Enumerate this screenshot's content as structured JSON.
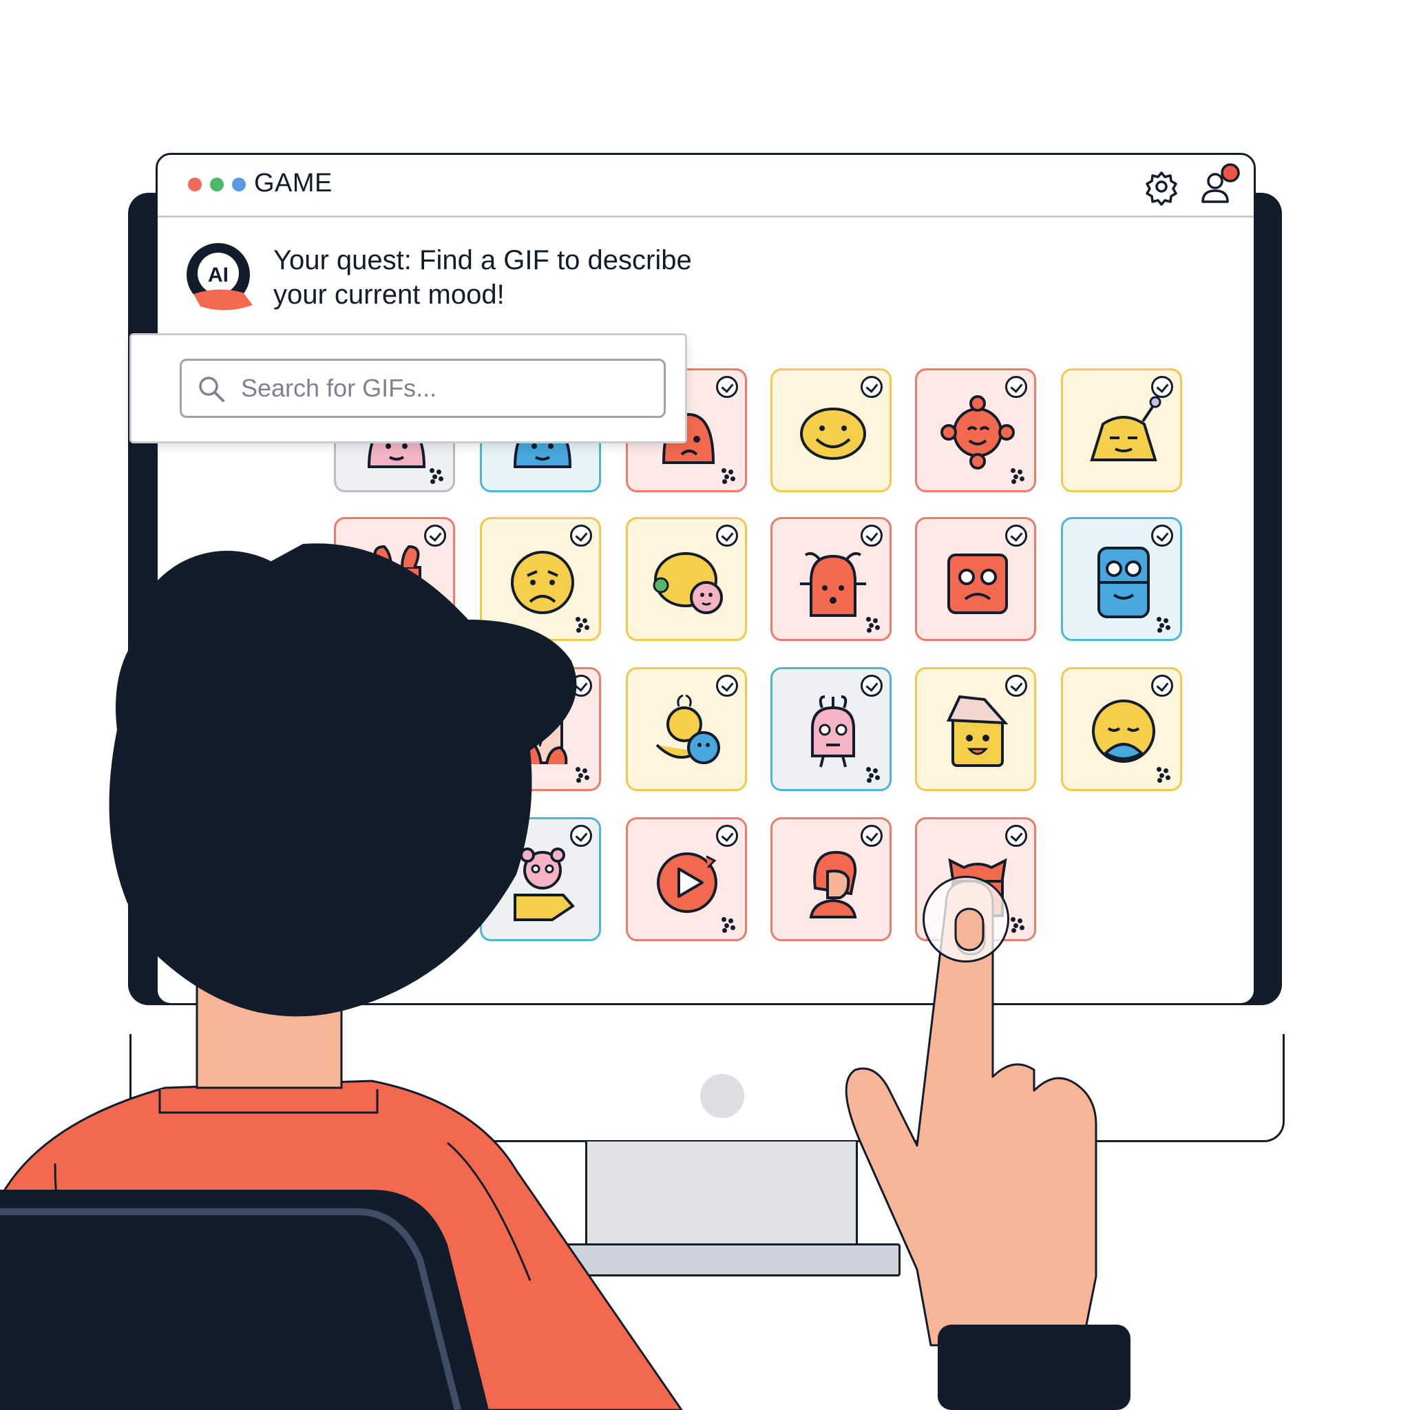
{
  "window": {
    "title": "GAME",
    "traffic_lights": [
      "#f06a55",
      "#4cb86a",
      "#5a9be0"
    ],
    "settings_icon": "gear-icon",
    "profile_icon": "user-notification-icon",
    "notification_color": "#f05545"
  },
  "assistant": {
    "badge_text": "AI",
    "quest_line1": "Your quest: Find a GIF to describe",
    "quest_line2": "your current mood!"
  },
  "search": {
    "placeholder": "Search for GIFs...",
    "value": ""
  },
  "colors": {
    "ink": "#131c2b",
    "coral": "#f2694f",
    "yellow": "#f6cf4a",
    "blue": "#48a7dd",
    "pink": "#f4b4c4",
    "skin": "#f6b596"
  },
  "gif_grid": {
    "rows": [
      [
        {
          "name": "green-blob",
          "icon": "blob-icon"
        },
        {
          "name": "blue-blob",
          "icon": "blob-icon"
        },
        {
          "name": "red-ghost",
          "icon": "ghost-icon"
        },
        {
          "name": "yellow-smile",
          "icon": "smile-icon"
        },
        {
          "name": "red-sun",
          "icon": "sun-face-icon"
        },
        {
          "name": "yellow-antenna",
          "icon": "antenna-face-icon"
        }
      ],
      [
        {
          "name": "red-bunny",
          "icon": "bunny-icon"
        },
        {
          "name": "yellow-sad",
          "icon": "sad-face-icon"
        },
        {
          "name": "yellow-chat",
          "icon": "chat-bubble-icon"
        },
        {
          "name": "red-bug",
          "icon": "bug-face-icon"
        },
        {
          "name": "red-square",
          "icon": "square-face-icon"
        },
        {
          "name": "blue-glasses",
          "icon": "glasses-face-icon"
        }
      ],
      [
        {
          "name": "red-door",
          "icon": "door-icon"
        },
        {
          "name": "yellow-bee",
          "icon": "bee-icon"
        },
        {
          "name": "pink-monster",
          "icon": "monster-icon"
        },
        {
          "name": "yellow-house",
          "icon": "house-face-icon"
        },
        {
          "name": "yellow-calm",
          "icon": "calm-face-icon"
        }
      ],
      [
        {
          "name": "pink-bear",
          "icon": "bear-icon"
        },
        {
          "name": "red-play",
          "icon": "play-icon"
        },
        {
          "name": "red-hair-person",
          "icon": "person-icon"
        },
        {
          "name": "red-cat",
          "icon": "cat-icon"
        }
      ]
    ]
  }
}
